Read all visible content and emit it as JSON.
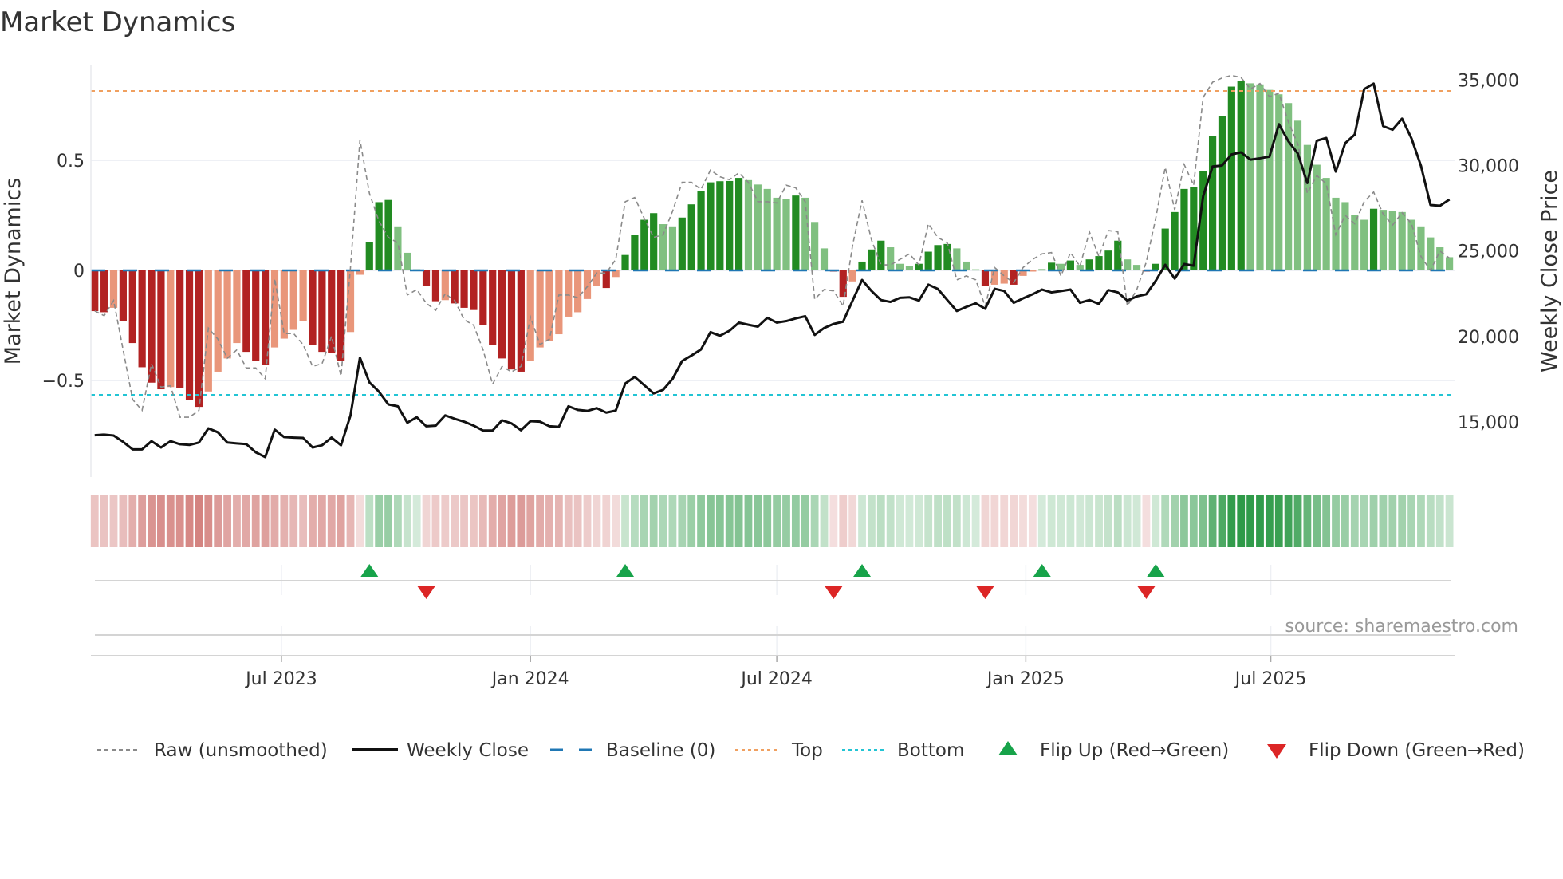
{
  "chart_data": {
    "type": "bar",
    "title": "Market Dynamics",
    "ylabel": "Market Dynamics",
    "y2label": "Weekly Close Price",
    "source": "source: sharemaestro.com",
    "frequency": "weekly",
    "week_start": "2023-02-13",
    "ylim": [
      -0.94,
      0.935
    ],
    "y2lim": [
      11780,
      35890
    ],
    "yticks": [
      {
        "value": 0.5,
        "label": "0.5"
      },
      {
        "value": 0,
        "label": "0"
      },
      {
        "value": -0.5,
        "label": "−0.5"
      }
    ],
    "y2ticks": [
      {
        "value": 35000,
        "label": "35,000"
      },
      {
        "value": 30000,
        "label": "30,000"
      },
      {
        "value": 25000,
        "label": "25,000"
      },
      {
        "value": 20000,
        "label": "20,000"
      },
      {
        "value": 15000,
        "label": "15,000"
      }
    ],
    "xticks": [
      {
        "date": "2023-07-01",
        "label": "Jul 2023"
      },
      {
        "date": "2024-01-01",
        "label": "Jan 2024"
      },
      {
        "date": "2024-07-01",
        "label": "Jul 2024"
      },
      {
        "date": "2025-01-01",
        "label": "Jan 2025"
      },
      {
        "date": "2025-07-01",
        "label": "Jul 2025"
      }
    ],
    "reference_lines": {
      "baseline": 0,
      "top": 0.815,
      "bottom": -0.565
    },
    "colors": {
      "pos_strong": "#228b22",
      "pos_weak": "#80c080",
      "neg_strong": "#b22222",
      "neg_weak": "#e9967a",
      "heat_pos": "#2e9a48",
      "heat_neg": "#c8605c",
      "raw": "#8a8a8a",
      "close": "#111111",
      "baseline": "#1f77b4",
      "top": "#f0a060",
      "bottom": "#22c4d4",
      "flip_up": "#17a34a",
      "flip_down": "#dc2626"
    },
    "series": [
      {
        "name": "Market Dynamics (smoothed)",
        "values": [
          -0.185,
          -0.19,
          -0.17,
          -0.23,
          -0.33,
          -0.44,
          -0.51,
          -0.54,
          -0.53,
          -0.535,
          -0.59,
          -0.62,
          -0.55,
          -0.46,
          -0.4,
          -0.33,
          -0.37,
          -0.41,
          -0.43,
          -0.35,
          -0.31,
          -0.27,
          -0.23,
          -0.34,
          -0.37,
          -0.375,
          -0.41,
          -0.28,
          -0.02,
          0.13,
          0.31,
          0.32,
          0.2,
          0.08,
          0.005,
          -0.07,
          -0.14,
          -0.135,
          -0.15,
          -0.17,
          -0.18,
          -0.25,
          -0.34,
          -0.4,
          -0.45,
          -0.46,
          -0.41,
          -0.35,
          -0.32,
          -0.29,
          -0.21,
          -0.19,
          -0.13,
          -0.07,
          -0.08,
          -0.03,
          0.07,
          0.16,
          0.23,
          0.26,
          0.21,
          0.2,
          0.24,
          0.3,
          0.36,
          0.4,
          0.405,
          0.406,
          0.42,
          0.41,
          0.39,
          0.37,
          0.33,
          0.325,
          0.34,
          0.33,
          0.22,
          0.1,
          -0.005,
          -0.12,
          -0.05,
          0.04,
          0.095,
          0.135,
          0.105,
          0.03,
          0.02,
          0.03,
          0.085,
          0.115,
          0.12,
          0.1,
          0.04,
          0.005,
          -0.07,
          -0.065,
          -0.06,
          -0.065,
          -0.025,
          -0.005,
          0.005,
          0.035,
          0.03,
          0.045,
          0.025,
          0.05,
          0.065,
          0.09,
          0.135,
          0.05,
          0.025,
          -0.005,
          0.03,
          0.19,
          0.265,
          0.37,
          0.38,
          0.45,
          0.61,
          0.7,
          0.835,
          0.86,
          0.85,
          0.845,
          0.82,
          0.8,
          0.76,
          0.68,
          0.57,
          0.48,
          0.42,
          0.33,
          0.31,
          0.25,
          0.23,
          0.28,
          0.275,
          0.27,
          0.265,
          0.23,
          0.2,
          0.15,
          0.105,
          0.06
        ]
      },
      {
        "name": "Raw (unsmoothed)",
        "values": [
          -0.184,
          -0.206,
          -0.137,
          -0.361,
          -0.586,
          -0.636,
          -0.424,
          -0.53,
          -0.524,
          -0.667,
          -0.667,
          -0.636,
          -0.262,
          -0.312,
          -0.399,
          -0.361,
          -0.443,
          -0.443,
          -0.492,
          -0.037,
          -0.287,
          -0.287,
          -0.337,
          -0.436,
          -0.424,
          -0.299,
          -0.48,
          0.013,
          0.593,
          0.35,
          0.225,
          0.15,
          0.125,
          -0.112,
          -0.087,
          -0.149,
          -0.181,
          -0.106,
          -0.137,
          -0.224,
          -0.249,
          -0.361,
          -0.517,
          -0.436,
          -0.461,
          -0.436,
          -0.212,
          -0.337,
          -0.312,
          -0.112,
          -0.112,
          -0.124,
          -0.074,
          -0.012,
          -0.012,
          0.05,
          0.312,
          0.331,
          0.237,
          0.15,
          0.162,
          0.269,
          0.4,
          0.4,
          0.368,
          0.456,
          0.425,
          0.412,
          0.443,
          0.4,
          0.312,
          0.312,
          0.306,
          0.387,
          0.375,
          0.312,
          -0.131,
          -0.087,
          -0.093,
          -0.162,
          0.113,
          0.318,
          0.138,
          0.025,
          0.025,
          0.05,
          0.075,
          0.025,
          0.212,
          0.15,
          0.125,
          -0.043,
          -0.025,
          -0.043,
          -0.162,
          0.013,
          -0.025,
          -0.056,
          0.013,
          0.05,
          0.075,
          0.081,
          -0.025,
          0.081,
          0.019,
          0.175,
          0.063,
          0.181,
          0.175,
          -0.162,
          -0.087,
          0.038,
          0.237,
          0.468,
          0.275,
          0.481,
          0.387,
          0.786,
          0.855,
          0.874,
          0.886,
          0.876,
          0.824,
          0.849,
          0.789,
          0.805,
          0.674,
          0.574,
          0.35,
          0.431,
          0.393,
          0.162,
          0.25,
          0.212,
          0.312,
          0.356,
          0.256,
          0.206,
          0.262,
          0.212,
          0.063,
          0.0,
          0.088,
          0.056
        ]
      },
      {
        "name": "Weekly Close",
        "axis": "right",
        "values": [
          14220,
          14255,
          14200,
          13830,
          13390,
          13390,
          13870,
          13500,
          13870,
          13690,
          13650,
          13790,
          14620,
          14390,
          13790,
          13740,
          13700,
          13220,
          12940,
          14545,
          14110,
          14080,
          14060,
          13500,
          13630,
          14080,
          13630,
          15370,
          18760,
          17310,
          16770,
          16020,
          15910,
          14950,
          15270,
          14740,
          14780,
          15380,
          15180,
          15010,
          14780,
          14490,
          14490,
          15090,
          14910,
          14510,
          15040,
          15010,
          14740,
          14710,
          15910,
          15700,
          15640,
          15800,
          15540,
          15660,
          17240,
          17630,
          17150,
          16665,
          16875,
          17515,
          18560,
          18885,
          19240,
          20250,
          20040,
          20330,
          20810,
          20685,
          20575,
          21090,
          20810,
          20900,
          21055,
          21185,
          20090,
          20495,
          20735,
          20865,
          22100,
          23305,
          22660,
          22130,
          22020,
          22260,
          22290,
          22100,
          23035,
          22780,
          22130,
          21490,
          21730,
          21940,
          21620,
          22790,
          22660,
          21970,
          22230,
          22470,
          22745,
          22580,
          22660,
          22745,
          21970,
          22130,
          21905,
          22715,
          22580,
          22100,
          22345,
          22470,
          23260,
          24195,
          23385,
          24240,
          24140,
          28210,
          29950,
          30010,
          30655,
          30780,
          30350,
          30430,
          30525,
          32425,
          31430,
          30705,
          28985,
          31460,
          31620,
          29655,
          31315,
          31815,
          34480,
          34805,
          32315,
          32105,
          32750,
          31590,
          29980,
          27695,
          27650,
          28020
        ]
      }
    ],
    "legend": {
      "placement": "bottom",
      "items": [
        {
          "label": "Raw (unsmoothed)",
          "kind": "raw"
        },
        {
          "label": "Weekly Close",
          "kind": "close"
        },
        {
          "label": "Baseline (0)",
          "kind": "baseline"
        },
        {
          "label": "Top",
          "kind": "top"
        },
        {
          "label": "Bottom",
          "kind": "bottom"
        },
        {
          "label": "Flip Up (Red→Green)",
          "kind": "flip_up"
        },
        {
          "label": "Flip Down (Green→Red)",
          "kind": "flip_down"
        }
      ]
    }
  }
}
